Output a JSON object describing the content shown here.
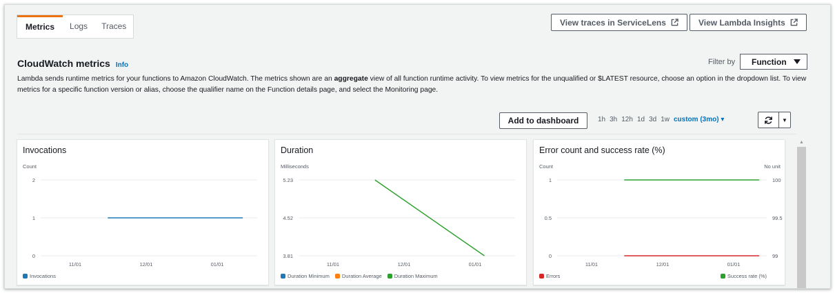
{
  "tabs": [
    {
      "label": "Metrics",
      "active": true
    },
    {
      "label": "Logs",
      "active": false
    },
    {
      "label": "Traces",
      "active": false
    }
  ],
  "header_buttons": {
    "servicelens": "View traces in ServiceLens",
    "insights": "View Lambda Insights"
  },
  "section": {
    "title": "CloudWatch metrics",
    "info": "Info",
    "filter_label": "Filter by",
    "filter_value": "Function",
    "desc_1": "Lambda sends runtime metrics for your functions to Amazon CloudWatch. The metrics shown are an ",
    "desc_bold": "aggregate",
    "desc_2": " view of all function runtime activity. To view metrics for the unqualified or $LATEST resource, choose an option in the dropdown list. To view metrics for a specific function version or alias, choose the qualifier name on the Function details page, and select the Monitoring page."
  },
  "toolbar": {
    "add_dashboard": "Add to dashboard",
    "ranges": [
      "1h",
      "3h",
      "12h",
      "1d",
      "3d",
      "1w"
    ],
    "custom_range": "custom (3mo)"
  },
  "colors": {
    "blue": "#1f77b4",
    "orange": "#ff7f0e",
    "green": "#2ca02c",
    "red": "#d62728",
    "tab_accent": "#ec7211",
    "link": "#0073bb"
  },
  "chart_data": [
    {
      "type": "line",
      "title": "Invocations",
      "ylabel": "Count",
      "x_ticks": [
        "11/01",
        "12/01",
        "01/01"
      ],
      "y_ticks": [
        "0",
        "1",
        "2"
      ],
      "ylim": [
        0,
        2
      ],
      "series": [
        {
          "name": "Invocations",
          "color": "#1f77b4",
          "x": [
            "11/15",
            "01/12"
          ],
          "values": [
            1,
            1
          ]
        }
      ]
    },
    {
      "type": "line",
      "title": "Duration",
      "ylabel": "Milliseconds",
      "x_ticks": [
        "11/01",
        "12/01",
        "01/01"
      ],
      "y_ticks": [
        "3.81",
        "4.52",
        "5.23"
      ],
      "ylim": [
        3.81,
        5.23
      ],
      "series": [
        {
          "name": "Duration Minimum",
          "color": "#1f77b4",
          "x": [],
          "values": []
        },
        {
          "name": "Duration Average",
          "color": "#ff7f0e",
          "x": [],
          "values": []
        },
        {
          "name": "Duration Maximum",
          "color": "#2ca02c",
          "x": [
            "11/19",
            "01/05"
          ],
          "values": [
            5.23,
            3.81
          ]
        }
      ]
    },
    {
      "type": "line",
      "title": "Error count and success rate (%)",
      "ylabel": "Count",
      "ylabel_right": "No unit",
      "x_ticks": [
        "11/01",
        "12/01",
        "01/01"
      ],
      "y_ticks": [
        "0",
        "0.5",
        "1"
      ],
      "y_ticks_right": [
        "99",
        "99.5",
        "100"
      ],
      "ylim": [
        0,
        1
      ],
      "ylim_right": [
        99,
        100
      ],
      "series": [
        {
          "name": "Errors",
          "color": "#d62728",
          "axis": "left",
          "x": [
            "11/15",
            "01/12"
          ],
          "values": [
            0,
            0
          ]
        },
        {
          "name": "Success rate (%)",
          "color": "#2ca02c",
          "axis": "right",
          "x": [
            "11/15",
            "01/12"
          ],
          "values": [
            100,
            100
          ]
        }
      ]
    }
  ]
}
